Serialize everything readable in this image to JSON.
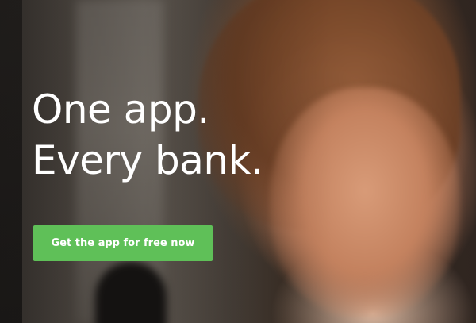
{
  "hero": {
    "headline_line1": "One app.",
    "headline_line2": "Every bank.",
    "cta_label": "Get the app for free now"
  },
  "colors": {
    "cta_background": "#5fc058",
    "headline_text": "#ffffff"
  }
}
